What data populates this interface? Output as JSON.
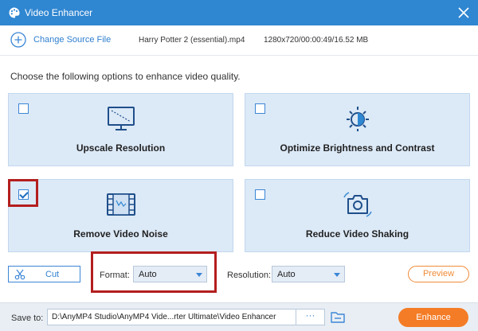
{
  "window": {
    "title": "Video Enhancer",
    "app_icon": "palette-icon",
    "close_icon": "close-icon"
  },
  "file": {
    "change_source_label": "Change Source File",
    "name": "Harry Potter 2 (essential).mp4",
    "info": "1280x720/00:00:49/16.52 MB"
  },
  "instruction": "Choose the following options to enhance video quality.",
  "options": [
    {
      "label": "Upscale Resolution",
      "checked": false,
      "icon": "monitor-icon"
    },
    {
      "label": "Optimize Brightness and Contrast",
      "checked": false,
      "icon": "brightness-icon"
    },
    {
      "label": "Remove Video Noise",
      "checked": true,
      "icon": "film-icon"
    },
    {
      "label": "Reduce Video Shaking",
      "checked": false,
      "icon": "camera-icon"
    }
  ],
  "controls": {
    "cut_label": "Cut",
    "format_label": "Format:",
    "format_value": "Auto",
    "resolution_label": "Resolution:",
    "resolution_value": "Auto",
    "preview_label": "Preview"
  },
  "footer": {
    "save_to_label": "Save to:",
    "path": "D:\\AnyMP4 Studio\\AnyMP4 Vide...rter Ultimate\\Video Enhancer",
    "browse_label": "···",
    "enhance_label": "Enhance"
  },
  "colors": {
    "titlebar": "#2f86d1",
    "accent": "#3b86d6",
    "option_bg": "#dce9f7",
    "enhance": "#f47c26",
    "highlight": "#b41e1e"
  }
}
